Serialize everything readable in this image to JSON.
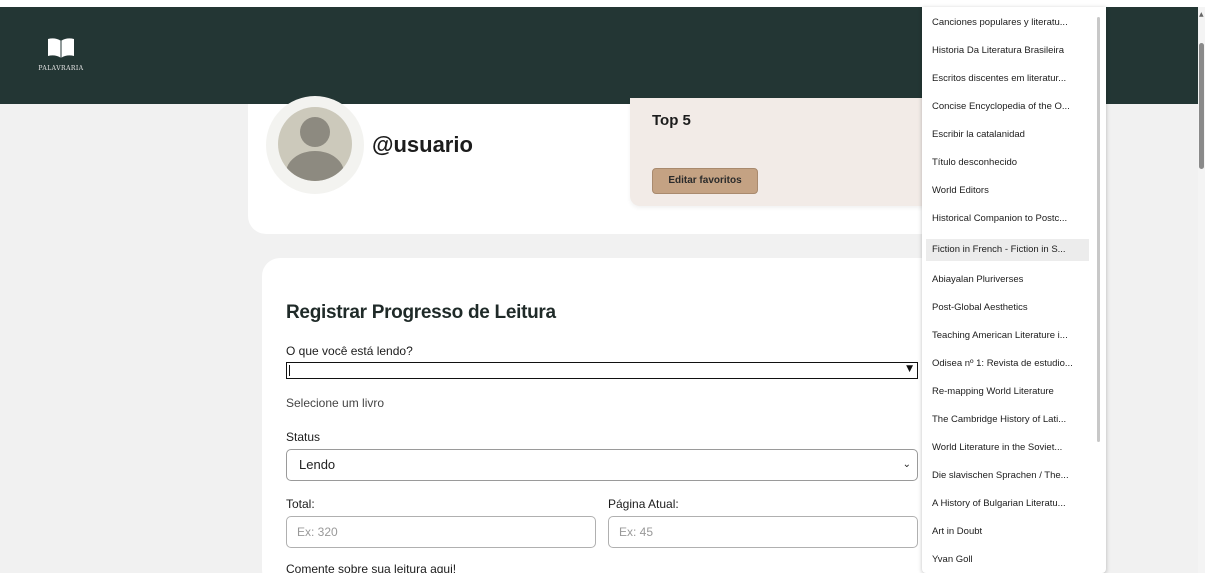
{
  "app": {
    "logo_text": "PALAVRARIA"
  },
  "profile": {
    "username": "@usuario"
  },
  "favorites": {
    "title": "Top 5",
    "edit_label": "Editar favoritos"
  },
  "form": {
    "title": "Registrar Progresso de Leitura",
    "book_label": "O que você está lendo?",
    "book_value": "",
    "select_hint": "Selecione um livro",
    "status_label": "Status",
    "status_value": "Lendo",
    "total_label": "Total:",
    "total_placeholder": "Ex: 320",
    "current_page_label": "Página Atual:",
    "current_page_placeholder": "Ex: 45",
    "comment_label": "Comente sobre sua leitura aqui!"
  },
  "dropdown": {
    "highlighted_index": 9,
    "items": [
      "Canciones populares y literatu...",
      "Historia Da Literatura Brasileira",
      "Escritos discentes em literatur...",
      "Concise Encyclopedia of the O...",
      "Escribir la catalanidad",
      "Título desconhecido",
      "World Editors",
      "Historical Companion to Postc...",
      "Fiction in French - Fiction in S...",
      "Abiayalan Pluriverses",
      "Post-Global Aesthetics",
      "Teaching American Literature i...",
      "Odisea nº 1: Revista de estudio...",
      "Re-mapping World Literature",
      "The Cambridge History of Lati...",
      "World Literature in the Soviet...",
      "Die slavischen Sprachen / The...",
      "A History of Bulgarian Literatu...",
      "Art in Doubt",
      "Yvan Goll"
    ]
  },
  "colors": {
    "header_bg": "#233634",
    "button_bg": "#c4a283",
    "top5_bg": "#f2ebe7"
  }
}
